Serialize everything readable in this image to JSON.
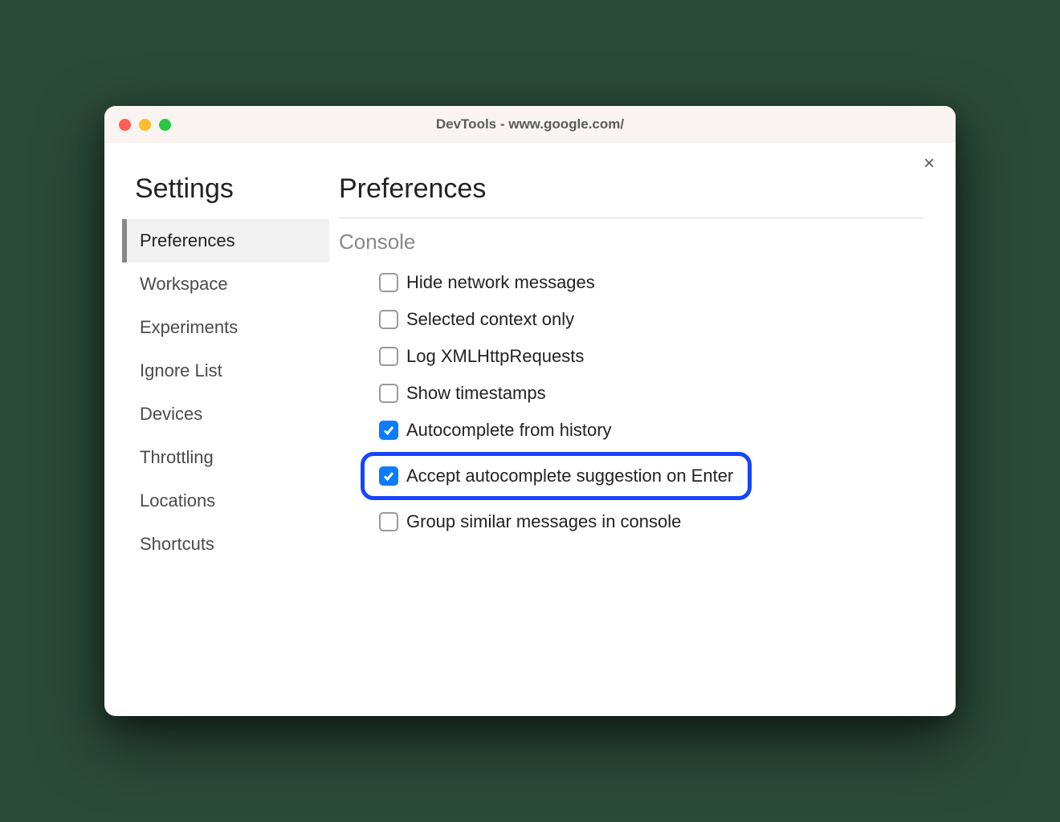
{
  "window": {
    "title": "DevTools - www.google.com/"
  },
  "sidebar": {
    "heading": "Settings",
    "items": [
      {
        "label": "Preferences",
        "active": true
      },
      {
        "label": "Workspace",
        "active": false
      },
      {
        "label": "Experiments",
        "active": false
      },
      {
        "label": "Ignore List",
        "active": false
      },
      {
        "label": "Devices",
        "active": false
      },
      {
        "label": "Throttling",
        "active": false
      },
      {
        "label": "Locations",
        "active": false
      },
      {
        "label": "Shortcuts",
        "active": false
      }
    ]
  },
  "main": {
    "heading": "Preferences",
    "section": {
      "title": "Console",
      "options": [
        {
          "label": "Hide network messages",
          "checked": false,
          "highlighted": false
        },
        {
          "label": "Selected context only",
          "checked": false,
          "highlighted": false
        },
        {
          "label": "Log XMLHttpRequests",
          "checked": false,
          "highlighted": false
        },
        {
          "label": "Show timestamps",
          "checked": false,
          "highlighted": false
        },
        {
          "label": "Autocomplete from history",
          "checked": true,
          "highlighted": false
        },
        {
          "label": "Accept autocomplete suggestion on Enter",
          "checked": true,
          "highlighted": true
        },
        {
          "label": "Group similar messages in console",
          "checked": false,
          "highlighted": false
        }
      ]
    }
  }
}
